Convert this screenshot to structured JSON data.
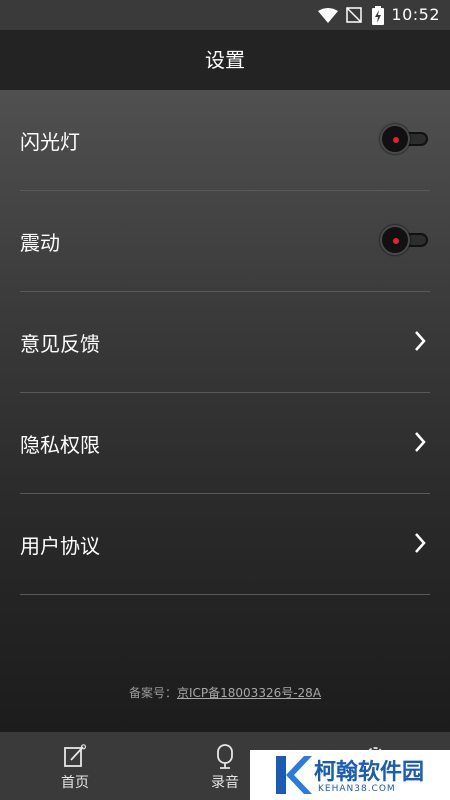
{
  "status_bar": {
    "time": "10:52",
    "icons": [
      "wifi-icon",
      "no-signal-icon",
      "battery-charging-icon"
    ]
  },
  "header": {
    "title": "设置"
  },
  "settings": [
    {
      "label": "闪光灯",
      "control": "toggle",
      "state": "off"
    },
    {
      "label": "震动",
      "control": "toggle",
      "state": "off"
    },
    {
      "label": "意见反馈",
      "control": "chevron"
    },
    {
      "label": "隐私权限",
      "control": "chevron"
    },
    {
      "label": "用户协议",
      "control": "chevron"
    }
  ],
  "footer": {
    "prefix": "备案号：",
    "icp": "京ICP备18003326号-28A"
  },
  "tabs": [
    {
      "label": "首页",
      "icon": "edit-icon"
    },
    {
      "label": "录音",
      "icon": "microphone-icon"
    },
    {
      "label": "",
      "icon": "settings-icon"
    }
  ],
  "watermark": {
    "name": "柯翰软件园",
    "url": "KEHAN38.COM"
  },
  "colors": {
    "accent": "#e8202a",
    "watermark": "#1a5bb5"
  }
}
